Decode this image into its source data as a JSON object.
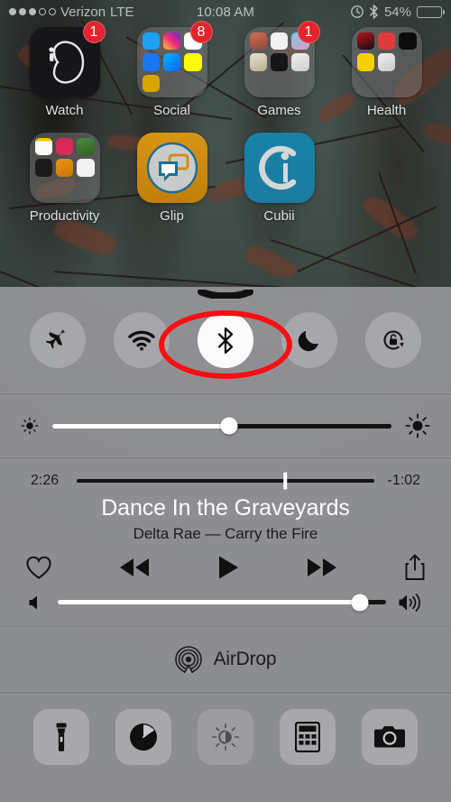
{
  "status_bar": {
    "signal_dots": [
      true,
      true,
      true,
      false,
      false
    ],
    "carrier": "Verizon",
    "network": "LTE",
    "time": "10:08 AM",
    "alarm_icon": "clock-icon",
    "bluetooth_icon": "bluetooth-icon",
    "battery_percent": "54%",
    "battery_level": 54,
    "battery_color": "#b99311"
  },
  "home_screen": {
    "rows": [
      [
        {
          "name": "watch",
          "label": "Watch",
          "badge": "1",
          "type": "app"
        },
        {
          "name": "social",
          "label": "Social",
          "badge": "8",
          "type": "folder"
        },
        {
          "name": "games",
          "label": "Games",
          "badge": "1",
          "type": "folder"
        },
        {
          "name": "health",
          "label": "Health",
          "badge": "",
          "type": "folder"
        }
      ],
      [
        {
          "name": "productivity",
          "label": "Productivity",
          "badge": "",
          "type": "folder"
        },
        {
          "name": "glip",
          "label": "Glip",
          "badge": "",
          "type": "app"
        },
        {
          "name": "cubii",
          "label": "Cubii",
          "badge": "",
          "type": "app"
        }
      ]
    ]
  },
  "control_center": {
    "grabber": "grabber-handle",
    "toggles": [
      {
        "name": "airplane-mode",
        "label": "Airplane Mode",
        "icon": "airplane-icon",
        "active": false
      },
      {
        "name": "wifi",
        "label": "Wi-Fi",
        "icon": "wifi-icon",
        "active": false
      },
      {
        "name": "bluetooth",
        "label": "Bluetooth",
        "icon": "bluetooth-icon",
        "active": true
      },
      {
        "name": "do-not-disturb",
        "label": "Do Not Disturb",
        "icon": "moon-icon",
        "active": false
      },
      {
        "name": "rotation-lock",
        "label": "Portrait Orientation Lock",
        "icon": "rotation-lock-icon",
        "active": false
      }
    ],
    "annotation": {
      "shape": "ellipse",
      "color": "#fd0d12",
      "target": "bluetooth"
    },
    "brightness": {
      "label": "Brightness",
      "value": 52,
      "low_icon": "brightness-low-icon",
      "high_icon": "brightness-high-icon"
    },
    "now_playing": {
      "elapsed": "2:26",
      "remaining": "-1:02",
      "progress": 70,
      "title": "Dance In the Graveyards",
      "subtitle": "Delta Rae — Carry the Fire",
      "controls": [
        {
          "name": "love-button",
          "label": "Love",
          "icon": "heart-icon"
        },
        {
          "name": "rewind-button",
          "label": "Rewind",
          "icon": "rewind-icon"
        },
        {
          "name": "play-button",
          "label": "Play",
          "icon": "play-icon"
        },
        {
          "name": "fast-forward-button",
          "label": "Fast Forward",
          "icon": "fast-forward-icon"
        },
        {
          "name": "share-button",
          "label": "Share",
          "icon": "share-icon"
        }
      ],
      "volume": {
        "label": "Volume",
        "value": 92,
        "low_icon": "volume-low-icon",
        "high_icon": "volume-high-icon"
      }
    },
    "airdrop": {
      "label": "AirDrop",
      "icon": "airdrop-icon"
    },
    "shortcuts": [
      {
        "name": "flashlight",
        "label": "Flashlight",
        "icon": "flashlight-icon",
        "dim": false
      },
      {
        "name": "timer",
        "label": "Timer",
        "icon": "timer-icon",
        "dim": false
      },
      {
        "name": "night-shift",
        "label": "Night Shift",
        "icon": "night-shift-icon",
        "dim": true
      },
      {
        "name": "calculator",
        "label": "Calculator",
        "icon": "calculator-icon",
        "dim": false
      },
      {
        "name": "camera",
        "label": "Camera",
        "icon": "camera-icon",
        "dim": false
      }
    ]
  }
}
